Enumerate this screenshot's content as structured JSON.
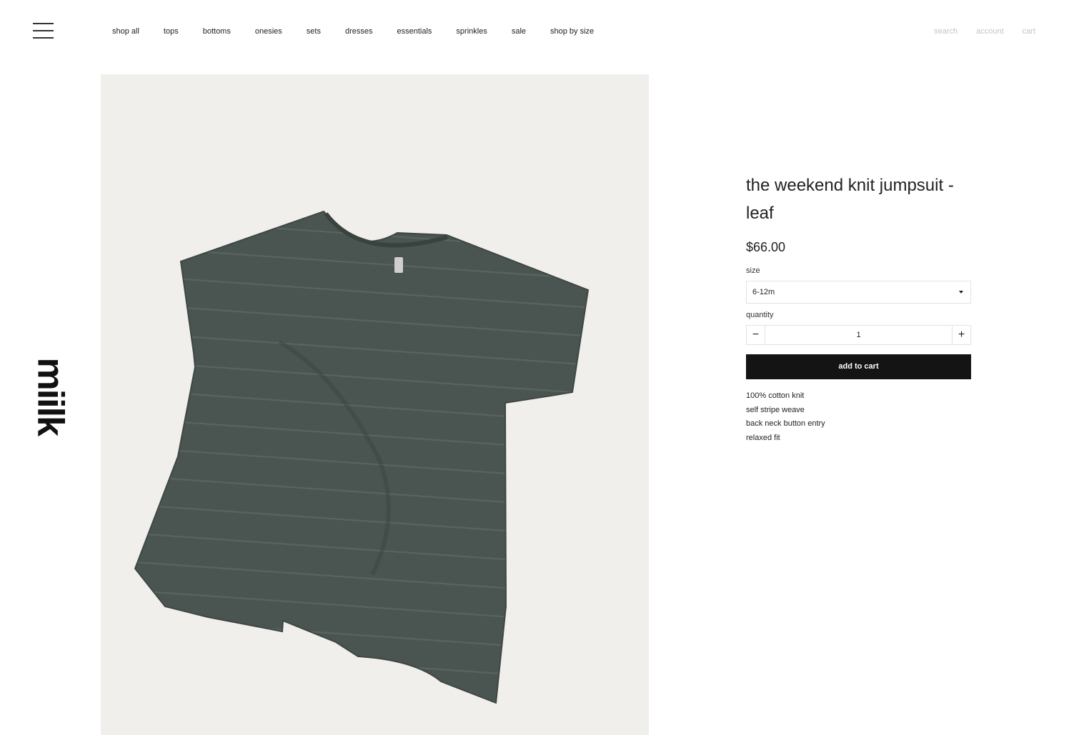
{
  "header": {
    "nav": [
      "shop all",
      "tops",
      "bottoms",
      "onesies",
      "sets",
      "dresses",
      "essentials",
      "sprinkles",
      "sale",
      "shop by size"
    ],
    "util": {
      "search": "search",
      "account": "account",
      "cart": "cart"
    }
  },
  "brand": {
    "logo_text": "miilk"
  },
  "product": {
    "title": "the weekend knit jumpsuit - leaf",
    "price": "$66.00",
    "size_label": "size",
    "size_value": "6-12m",
    "quantity_label": "quantity",
    "quantity_value": "1",
    "minus_icon": "−",
    "plus_icon": "+",
    "add_to_cart": "add to cart",
    "features": [
      "100% cotton knit",
      "self stripe weave",
      "back neck button entry",
      "relaxed fit"
    ]
  },
  "colors": {
    "garment": "#4a5450",
    "button": "#141414",
    "photo_bg": "#f1efec"
  }
}
